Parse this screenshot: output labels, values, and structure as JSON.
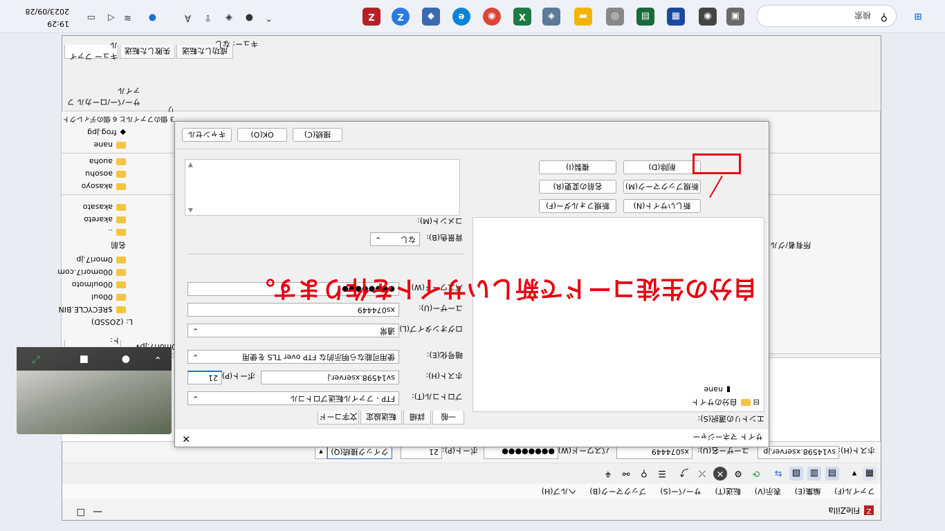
{
  "window": {
    "app_title": "FileZilla",
    "queue_status": "キュー: なし"
  },
  "menu": [
    "ファイル(F)",
    "編集(E)",
    "表示(V)",
    "転送(T)",
    "サーバー(S)",
    "ブックマーク(B)",
    "ヘルプ(H)"
  ],
  "quickconnect": {
    "host_label": "ホスト(H):",
    "host_value": "sv14598.xserver.jp",
    "user_label": "ユーザー名(U):",
    "user_value": "xs074449",
    "pass_label": "パスワード(W):",
    "pass_value": "●●●●●●●●",
    "port_label": "ポート(P):",
    "port_value": "21",
    "button": "クイック接続(Q)"
  },
  "local_panel": {
    "site_label": "ローカル サイト:",
    "site_path": "L:¥0mori7.jp¥",
    "tree": [
      "L: (2OSSD)",
      "$RECYCLE.BIN",
      "00oul",
      "00oulmoto",
      "00omori7.com",
      "0mori7.jp"
    ],
    "list_header": "名前",
    "files": [
      "..",
      "akareto",
      "akasato",
      "akasoyo",
      "aosohu",
      "auoha",
      "nane",
      "frog.jpg"
    ],
    "status": "3 個のファイルと 6 個のディレクトリ",
    "section_label": "サーバー/ローカル ファイル"
  },
  "remote_panel": {
    "owner_header": "所有者/グル..."
  },
  "queue_tabs": [
    "キュー ファイル",
    "失敗した転送",
    "成功した転送"
  ],
  "site_manager": {
    "title": "サイト マネージャー",
    "select_label": "エントリの選択(S):",
    "root_label": "自分のサイト",
    "new_site_name": "nane",
    "tabs": [
      "一般",
      "詳細",
      "転送設定",
      "文字コード"
    ],
    "protocol_label": "プロトコル(T):",
    "protocol_value": "FTP - ファイル転送プロトコル",
    "host_label": "ホスト(H):",
    "host_value": "sv14598.xserver.j",
    "port_label": "ポート(P):",
    "port_value": "21",
    "encryption_label": "暗号化(E):",
    "encryption_value": "使用可能なら明示的な FTP over TLS を使用",
    "logon_label": "ログオンタイプ(L):",
    "logon_value": "通常",
    "user_label": "ユーザー(U):",
    "user_value": "xs074449",
    "pass_label": "パスワード(W):",
    "pass_value": "●●●●●●●●",
    "bg_color_label": "背景色(B):",
    "bg_color_value": "なし",
    "comment_label": "コメント(M):",
    "left_buttons": [
      "新しいサイト(N)",
      "新規フォルダー(F)",
      "新規ブックマーク(M)",
      "名前の変更(R)",
      "削除(D)",
      "複製(I)"
    ],
    "connect_button": "接続(C)",
    "ok_button": "OK(O)",
    "cancel_button": "キャンセル"
  },
  "annotation": "自分の生徒コードで新しいサイトを作ります。",
  "taskbar": {
    "search_placeholder": "検索",
    "time": "19:29",
    "date": "2023/09/28"
  },
  "colors": {
    "annotation_red": "#e60012",
    "folder_yellow": "#f5c542",
    "taskbar_bg": "#eef1f7"
  }
}
